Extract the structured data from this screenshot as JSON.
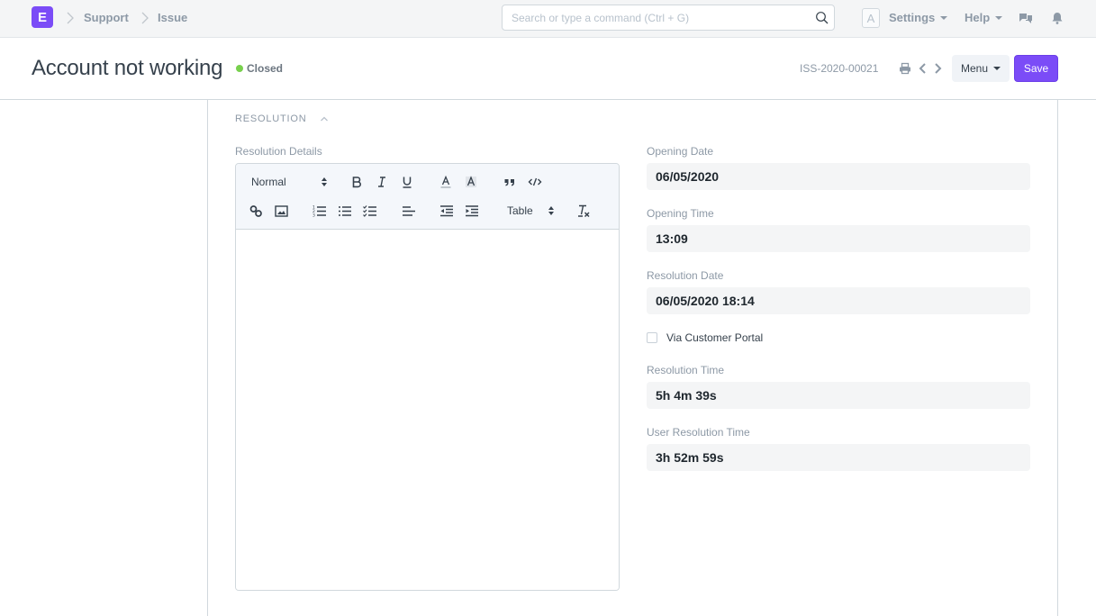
{
  "navbar": {
    "logo_letter": "E",
    "breadcrumbs": [
      "Support",
      "Issue"
    ],
    "search_placeholder": "Search or type a command (Ctrl + G)",
    "avatar_letter": "A",
    "settings_label": "Settings",
    "help_label": "Help"
  },
  "page": {
    "title": "Account not working",
    "status": "Closed",
    "status_color": "#78d04d",
    "doc_id": "ISS-2020-00021",
    "menu_label": "Menu",
    "save_label": "Save",
    "accent_color": "#7b4cf7"
  },
  "section": {
    "title": "RESOLUTION",
    "resolution_details_label": "Resolution Details",
    "editor": {
      "format_select": "Normal",
      "table_select": "Table",
      "content": ""
    },
    "fields": [
      {
        "label": "Opening Date",
        "value": "06/05/2020"
      },
      {
        "label": "Opening Time",
        "value": "13:09"
      },
      {
        "label": "Resolution Date",
        "value": "06/05/2020 18:14"
      },
      {
        "label": "Resolution Time",
        "value": "5h 4m 39s"
      },
      {
        "label": "User Resolution Time",
        "value": "3h 52m 59s"
      }
    ],
    "via_customer_portal": {
      "label": "Via Customer Portal",
      "checked": false
    }
  }
}
